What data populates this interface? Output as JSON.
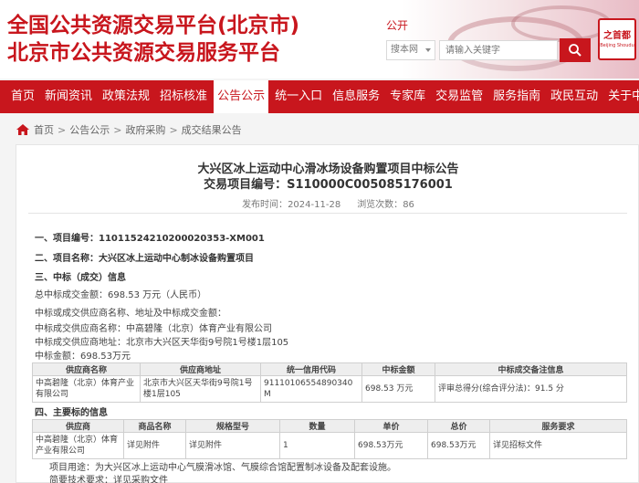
{
  "header": {
    "title_line1": "全国公共资源交易平台(北京市)",
    "title_line2": "北京市公共资源交易服务平台",
    "public_link": "公开",
    "search_select": "搜本网",
    "search_placeholder": "请输入关键字",
    "logo_chars": "之首都",
    "logo_sub": "Beijing Shoudu",
    "brand_color": "#c8161d"
  },
  "nav": {
    "items": [
      "首页",
      "新闻资讯",
      "政策法规",
      "招标核准",
      "公告公示",
      "统一入口",
      "信息服务",
      "专家库",
      "交易监管",
      "服务指南",
      "政民互动",
      "关于中心"
    ],
    "active_index": 4
  },
  "breadcrumb": [
    "首页",
    "公告公示",
    "政府采购",
    "成交结果公告"
  ],
  "doc": {
    "title": "大兴区冰上运动中心滑冰场设备购置项目中标公告",
    "code": "交易项目编号：S110000C005085176001",
    "publish_label": "发布时间：",
    "publish_date": "2024-11-28",
    "views_label": "浏览次数：",
    "views": "86"
  },
  "sections": {
    "s1": "一、项目编号：11011524210200020353-XM001",
    "s2": "二、项目名称：大兴区冰上运动中心制冰设备购置项目",
    "s3": "三、中标（成交）信息",
    "s3_total": "总中标成交金额：698.53 万元（人民币）",
    "s3_info": "中标或成交供应商名称、地址及中标成交金额：",
    "s3_name": "中标成交供应商名称：中高碧隆（北京）体育产业有限公司",
    "s3_addr": "中标成交供应商地址：北京市大兴区天华街9号院1号楼1层105",
    "s3_amount": "中标金额：698.53万元",
    "s4": "四、主要标的信息",
    "s4_use": "项目用途：为大兴区冰上运动中心气膜滑冰馆、气膜综合馆配置制冰设备及配套设施。",
    "s4_req": "简要技术要求：详见采购文件"
  },
  "table1": {
    "headers": [
      "供应商名称",
      "供应商地址",
      "统一信用代码",
      "中标金额",
      "中标成交备注信息"
    ],
    "rows": [
      [
        "中高碧隆（北京）体育产业有限公司",
        "北京市大兴区天华街9号院1号楼1层105",
        "91110106554890340M",
        "698.53 万元",
        "评审总得分(综合评分法)：91.5 分"
      ]
    ]
  },
  "table2": {
    "headers": [
      "供应商",
      "商品名称",
      "规格型号",
      "数量",
      "单价",
      "总价",
      "服务要求"
    ],
    "rows": [
      [
        "中高碧隆（北京）体育产业有限公司",
        "详见附件",
        "详见附件",
        "1",
        "698.53万元",
        "698.53万元",
        "详见招标文件"
      ]
    ]
  }
}
